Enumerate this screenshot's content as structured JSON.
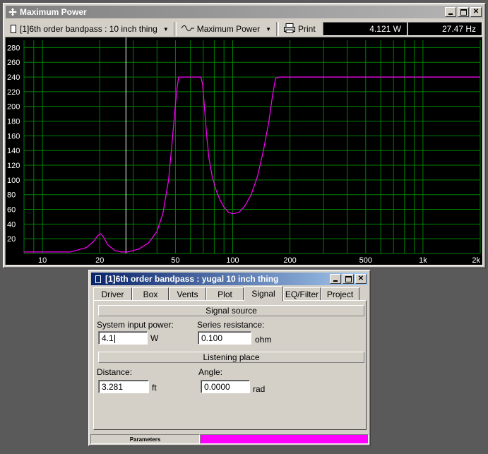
{
  "main_window": {
    "title": "Maximum Power",
    "title_icon": "move-cross-icon",
    "toolbar": {
      "project_select": "[1]6th order bandpass : 10 inch thing",
      "graph_select": "Maximum Power",
      "print_label": "Print"
    },
    "readout_power": "4.121 W",
    "readout_freq": "27.47 Hz"
  },
  "chart_data": {
    "type": "line",
    "title": "",
    "xlabel": "",
    "ylabel": "",
    "xscale": "log",
    "xlim": [
      8,
      2000
    ],
    "ylim": [
      0,
      290
    ],
    "x_tick_labels": [
      "10",
      "20",
      "50",
      "100",
      "200",
      "500",
      "1k",
      "2k"
    ],
    "x_ticks": [
      10,
      20,
      50,
      100,
      200,
      500,
      1000,
      2000
    ],
    "y_ticks": [
      20,
      40,
      60,
      80,
      100,
      120,
      140,
      160,
      180,
      200,
      220,
      240,
      260,
      280
    ],
    "y_tick_labels": [
      "20",
      "40",
      "60",
      "80",
      "100",
      "120",
      "140",
      "160",
      "180",
      "200",
      "220",
      "240",
      "260",
      "280"
    ],
    "grid": true,
    "cursor_x": 27.47,
    "colors": {
      "background": "#000000",
      "grid": "#008000",
      "line": "#ff00ff",
      "cursor": "#ffffff",
      "axis_text": "#ffffff"
    },
    "series": [
      {
        "x": [
          8,
          14,
          17,
          18.5,
          19.5,
          20.2,
          21,
          22,
          24,
          26,
          28,
          32,
          36,
          40,
          43,
          46,
          48,
          49.5,
          51,
          52,
          53,
          54,
          56,
          60,
          65,
          68,
          69.5,
          71,
          73,
          75,
          78,
          82,
          86,
          90,
          95,
          100,
          108,
          116,
          125,
          135,
          145,
          155,
          162,
          168,
          175,
          200,
          300,
          500,
          1000,
          2000
        ],
        "y": [
          2,
          2,
          8,
          16,
          24,
          27,
          22,
          12,
          4,
          2,
          2,
          6,
          14,
          30,
          55,
          100,
          150,
          190,
          225,
          240,
          240,
          240,
          240,
          240,
          240,
          240,
          230,
          200,
          160,
          130,
          105,
          85,
          72,
          63,
          56,
          54,
          56,
          65,
          80,
          105,
          140,
          180,
          215,
          238,
          240,
          240,
          240,
          240,
          240,
          240
        ]
      }
    ]
  },
  "dialog": {
    "title": "[1]6th order bandpass : yugal 10 inch thing",
    "tabs": [
      "Driver",
      "Box",
      "Vents",
      "Plot",
      "Signal",
      "EQ/Filter",
      "Project"
    ],
    "selected_tab": "Signal",
    "signal_source_header": "Signal source",
    "input_power_label": "System input power:",
    "input_power_value": "4.1",
    "input_power_unit": "W",
    "series_res_label": "Series resistance:",
    "series_res_value": "0.100",
    "series_res_unit": "ohm",
    "listening_header": "Listening place",
    "distance_label": "Distance:",
    "distance_value": "3.281",
    "distance_unit": "ft",
    "angle_label": "Angle:",
    "angle_value": "0.0000",
    "angle_unit": "rad",
    "status_text": "Parameters",
    "status_color": "#ff00ff"
  }
}
